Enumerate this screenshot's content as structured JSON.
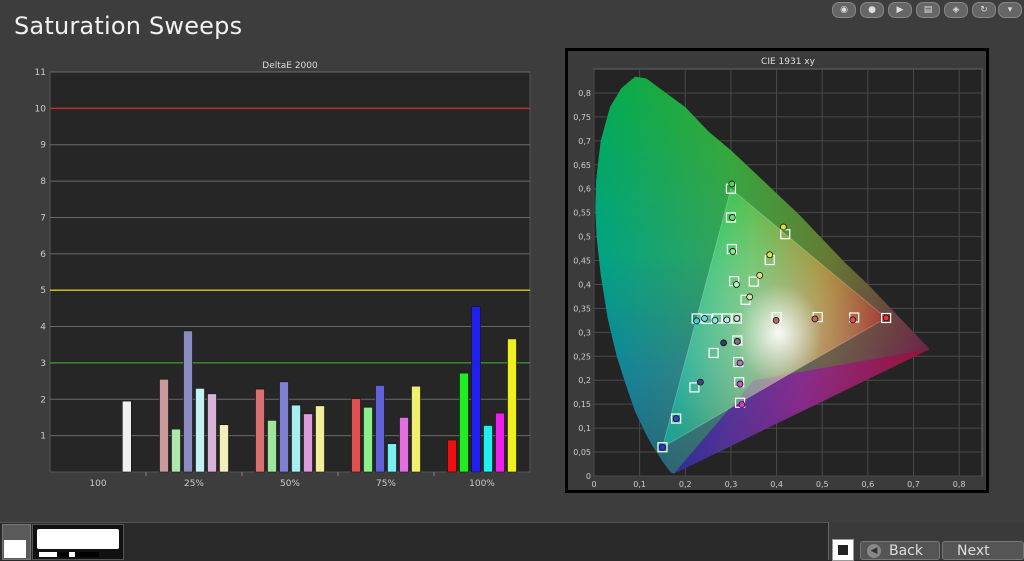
{
  "page": {
    "title": "Saturation Sweeps"
  },
  "colors": {
    "red_line": "#c8302c",
    "yellow_line": "#d8c820",
    "green_line": "#3a9a2a",
    "grid": "#6a6a6a"
  },
  "chart_data": [
    {
      "type": "bar",
      "title": "DeltaE 2000",
      "ylim": [
        0,
        11
      ],
      "yticks": [
        1,
        2,
        3,
        4,
        5,
        6,
        7,
        8,
        9,
        10,
        11
      ],
      "categories": [
        "100",
        "25%",
        "50%",
        "75%",
        "100%"
      ],
      "threshold_lines": [
        10,
        5,
        3
      ],
      "groups": [
        {
          "category": "100",
          "bars": [
            {
              "value": 1.95,
              "color": "#f0f0f0"
            }
          ]
        },
        {
          "category": "25%",
          "bars": [
            {
              "value": 2.55,
              "color": "#c89a9a"
            },
            {
              "value": 1.18,
              "color": "#aee6ae"
            },
            {
              "value": 3.88,
              "color": "#8a8cc0"
            },
            {
              "value": 2.3,
              "color": "#c2f2f2"
            },
            {
              "value": 2.15,
              "color": "#d8b2d8"
            },
            {
              "value": 1.3,
              "color": "#f2f0b8"
            }
          ]
        },
        {
          "category": "50%",
          "bars": [
            {
              "value": 2.28,
              "color": "#d87070"
            },
            {
              "value": 1.42,
              "color": "#9ee69e"
            },
            {
              "value": 2.48,
              "color": "#8080d2"
            },
            {
              "value": 1.84,
              "color": "#a6eef0"
            },
            {
              "value": 1.6,
              "color": "#dc9cdc"
            },
            {
              "value": 1.82,
              "color": "#f2ee9a"
            }
          ]
        },
        {
          "category": "75%",
          "bars": [
            {
              "value": 2.02,
              "color": "#e05050"
            },
            {
              "value": 1.78,
              "color": "#8af08a"
            },
            {
              "value": 2.38,
              "color": "#6060d8"
            },
            {
              "value": 0.78,
              "color": "#7aeef2"
            },
            {
              "value": 1.5,
              "color": "#e070e0"
            },
            {
              "value": 2.36,
              "color": "#f2ee70"
            }
          ]
        },
        {
          "category": "100%",
          "bars": [
            {
              "value": 0.88,
              "color": "#ee1010"
            },
            {
              "value": 2.72,
              "color": "#20ee20"
            },
            {
              "value": 4.55,
              "color": "#2020ee"
            },
            {
              "value": 1.28,
              "color": "#20eef0"
            },
            {
              "value": 1.62,
              "color": "#ee20ee"
            },
            {
              "value": 3.66,
              "color": "#f0f020"
            }
          ]
        }
      ]
    },
    {
      "type": "scatter",
      "title": "CIE 1931 xy",
      "xlim": [
        0,
        0.85
      ],
      "ylim": [
        0,
        0.85
      ],
      "xticks": [
        "0",
        "0,1",
        "0,2",
        "0,3",
        "0,4",
        "0,5",
        "0,6",
        "0,7",
        "0,8"
      ],
      "yticks": [
        "0",
        "0,05",
        "0,1",
        "0,15",
        "0,2",
        "0,25",
        "0,3",
        "0,35",
        "0,4",
        "0,45",
        "0,5",
        "0,55",
        "0,6",
        "0,65",
        "0,7",
        "0,75",
        "0,8"
      ],
      "gamut_triangle": [
        [
          0.64,
          0.33
        ],
        [
          0.3,
          0.6
        ],
        [
          0.15,
          0.06
        ]
      ],
      "targets": [
        [
          0.3127,
          0.329
        ],
        [
          0.64,
          0.33
        ],
        [
          0.57,
          0.331
        ],
        [
          0.49,
          0.332
        ],
        [
          0.4,
          0.332
        ],
        [
          0.3,
          0.6
        ],
        [
          0.3,
          0.54
        ],
        [
          0.302,
          0.474
        ],
        [
          0.307,
          0.407
        ],
        [
          0.15,
          0.06
        ],
        [
          0.18,
          0.12
        ],
        [
          0.22,
          0.185
        ],
        [
          0.262,
          0.257
        ],
        [
          0.225,
          0.329
        ],
        [
          0.248,
          0.328
        ],
        [
          0.27,
          0.329
        ],
        [
          0.291,
          0.329
        ],
        [
          0.32,
          0.153
        ],
        [
          0.318,
          0.196
        ],
        [
          0.316,
          0.238
        ],
        [
          0.314,
          0.283
        ],
        [
          0.419,
          0.505
        ],
        [
          0.385,
          0.451
        ],
        [
          0.35,
          0.406
        ],
        [
          0.332,
          0.368
        ]
      ],
      "measured": [
        {
          "x": 0.313,
          "y": 0.329,
          "color": "#d8d8d8"
        },
        {
          "x": 0.64,
          "y": 0.33,
          "color": "#ee3030"
        },
        {
          "x": 0.567,
          "y": 0.326,
          "color": "#e04a4a"
        },
        {
          "x": 0.484,
          "y": 0.328,
          "color": "#cc6060"
        },
        {
          "x": 0.399,
          "y": 0.325,
          "color": "#bb6666"
        },
        {
          "x": 0.302,
          "y": 0.61,
          "color": "#40e040"
        },
        {
          "x": 0.303,
          "y": 0.54,
          "color": "#60e860"
        },
        {
          "x": 0.304,
          "y": 0.469,
          "color": "#88ec88"
        },
        {
          "x": 0.312,
          "y": 0.4,
          "color": "#b8f0b8"
        },
        {
          "x": 0.15,
          "y": 0.06,
          "color": "#3030d0"
        },
        {
          "x": 0.18,
          "y": 0.12,
          "color": "#4040c8"
        },
        {
          "x": 0.233,
          "y": 0.196,
          "color": "#404090"
        },
        {
          "x": 0.284,
          "y": 0.278,
          "color": "#3a3a60"
        },
        {
          "x": 0.225,
          "y": 0.324,
          "color": "#30d8e0"
        },
        {
          "x": 0.242,
          "y": 0.329,
          "color": "#60e0e6"
        },
        {
          "x": 0.265,
          "y": 0.325,
          "color": "#90e8ec"
        },
        {
          "x": 0.291,
          "y": 0.326,
          "color": "#b8f0f2"
        },
        {
          "x": 0.324,
          "y": 0.149,
          "color": "#e030e0"
        },
        {
          "x": 0.32,
          "y": 0.192,
          "color": "#d050d0"
        },
        {
          "x": 0.32,
          "y": 0.236,
          "color": "#b870b8"
        },
        {
          "x": 0.314,
          "y": 0.281,
          "color": "#8a6a8a"
        },
        {
          "x": 0.415,
          "y": 0.52,
          "color": "#e0e020"
        },
        {
          "x": 0.385,
          "y": 0.462,
          "color": "#e0e050"
        },
        {
          "x": 0.363,
          "y": 0.419,
          "color": "#e0e080"
        },
        {
          "x": 0.341,
          "y": 0.374,
          "color": "#e0e0b0"
        }
      ]
    }
  ],
  "toolbar": {
    "back_label": "Back",
    "next_label": "Next",
    "icons": [
      "eye-icon",
      "record-icon",
      "play-icon",
      "save-icon",
      "sync-icon",
      "refresh-icon",
      "dropdown-icon"
    ]
  }
}
